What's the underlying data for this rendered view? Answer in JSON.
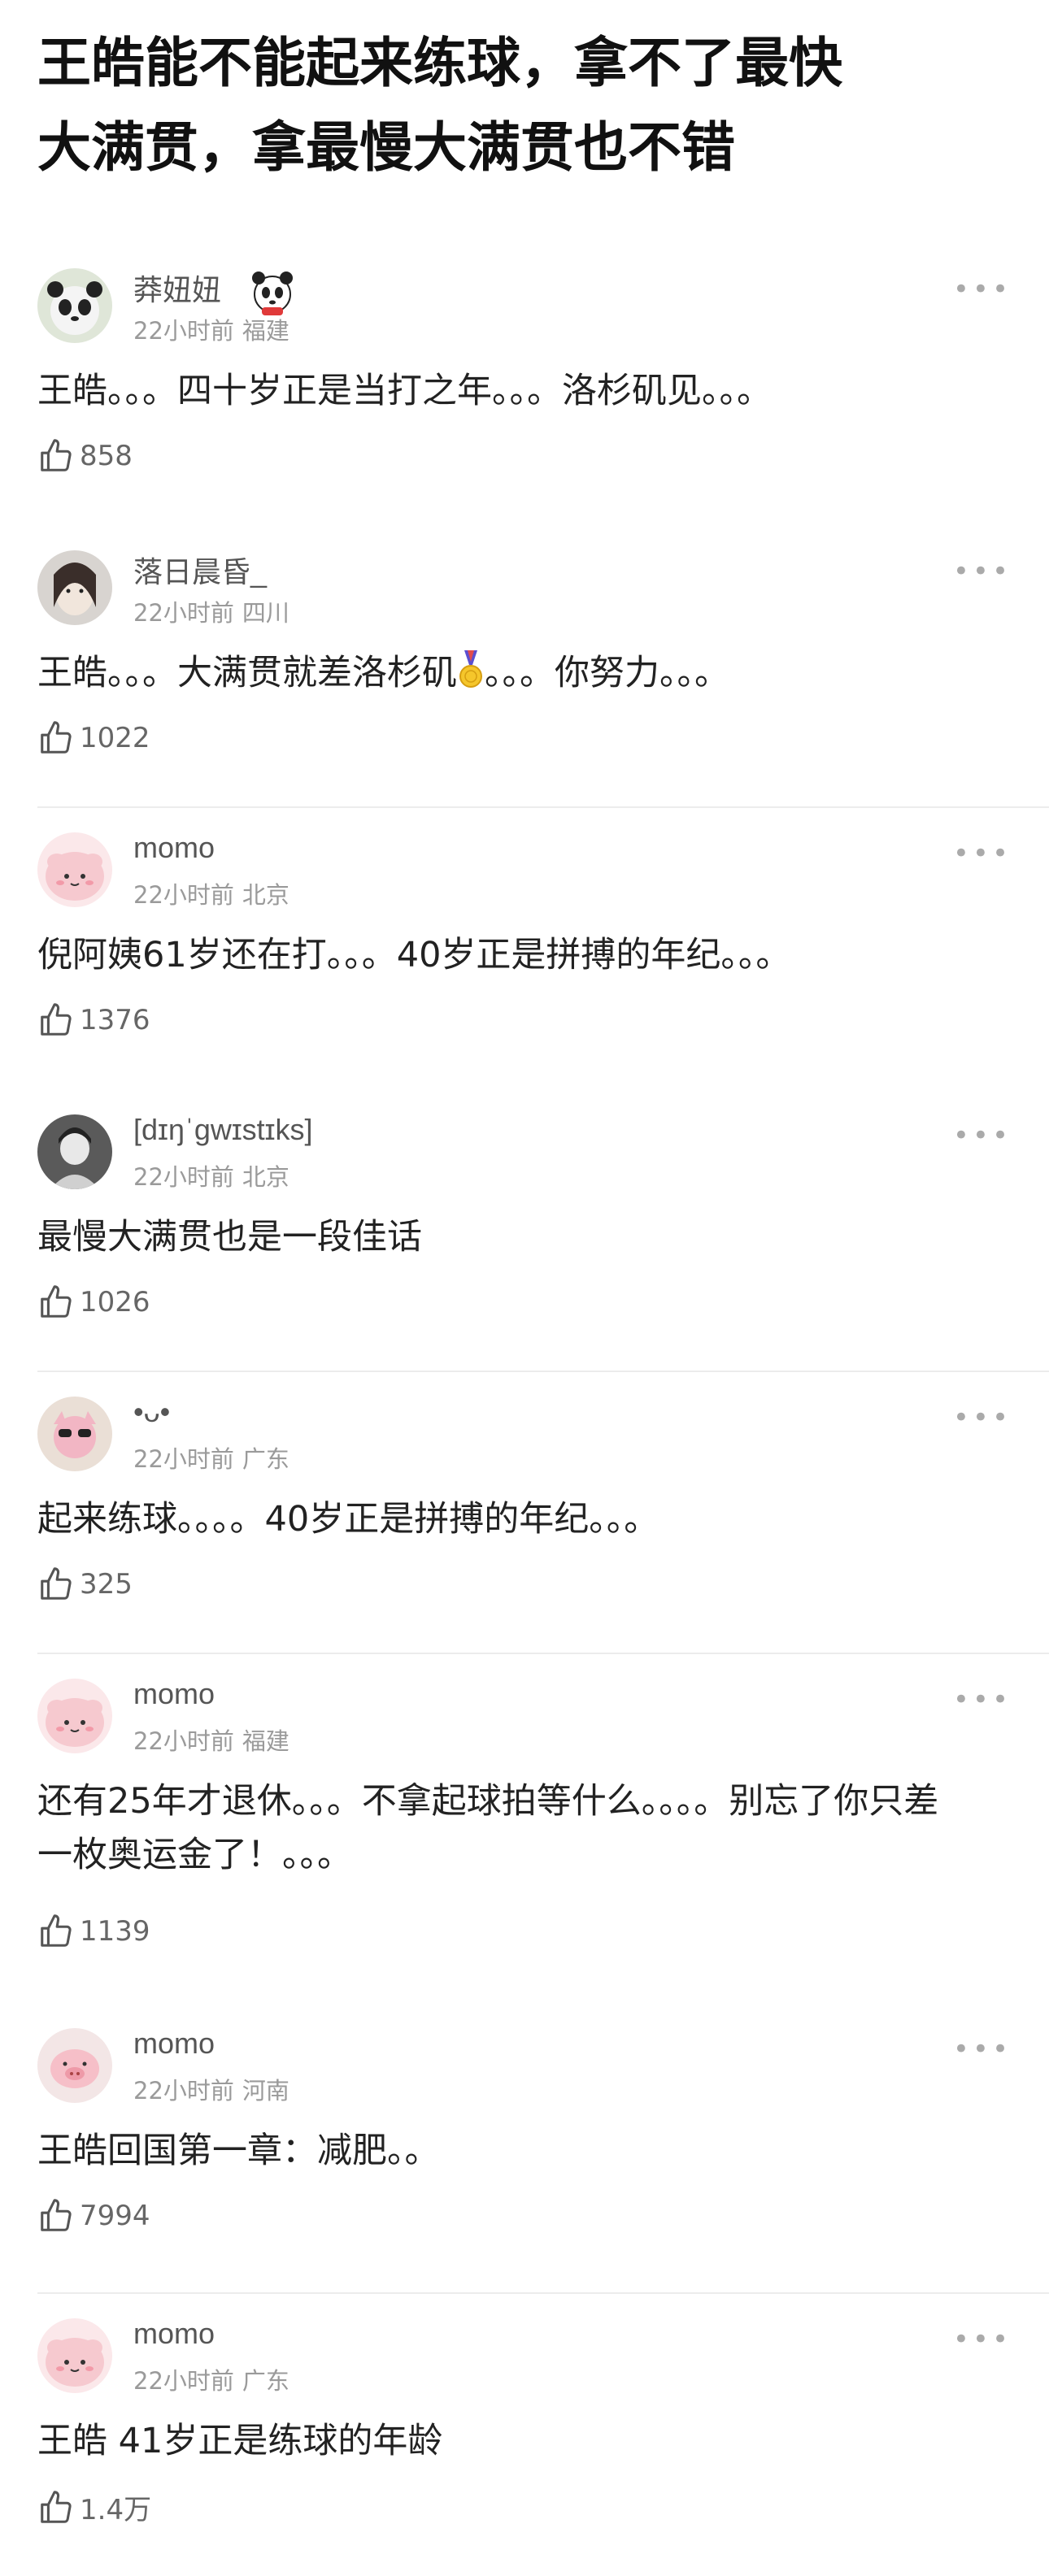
{
  "post": {
    "title": "王皓能不能起来练球，拿不了最快\n大满贯，拿最慢大满贯也不错"
  },
  "comments": [
    {
      "username": "莽妞妞",
      "time": "22小时前",
      "location": "福建",
      "text": "王皓。。。四十岁正是当打之年。。。洛杉矶见。。。",
      "likes": "858",
      "badge_icon": "panda-icon"
    },
    {
      "username": "落日晨昏_",
      "time": "22小时前",
      "location": "四川",
      "text_before": "王皓。。。大满贯就差洛杉矶",
      "text_after": "。。。你努力。。。",
      "likes": "1022",
      "inline_icon": "gold-medal-icon"
    },
    {
      "username": "momo",
      "time": "22小时前",
      "location": "北京",
      "text": "倪阿姨61岁还在打。。。40岁正是拼搏的年纪。。。",
      "likes": "1376"
    },
    {
      "username": "[dɪŋˈɡwɪstɪks]",
      "time": "22小时前",
      "location": "北京",
      "text": "最慢大满贯也是一段佳话",
      "likes": "1026"
    },
    {
      "username": "•ᴗ•",
      "time": "22小时前",
      "location": "广东",
      "text": "起来练球。。。。40岁正是拼搏的年纪。。。",
      "likes": "325"
    },
    {
      "username": "momo",
      "time": "22小时前",
      "location": "福建",
      "text": "还有25年才退休。。。不拿起球拍等什么。。。。别忘了你只差一枚奥运金了！。。。",
      "likes": "1139"
    },
    {
      "username": "momo",
      "time": "22小时前",
      "location": "河南",
      "text": "王皓回国第一章：减肥。。",
      "likes": "7994"
    },
    {
      "username": "momo",
      "time": "22小时前",
      "location": "广东",
      "text": "王皓 41岁正是练球的年龄",
      "likes": "1.4万"
    }
  ],
  "icons": {
    "more": "more-dots-icon",
    "like": "thumbs-up-icon"
  },
  "colors": {
    "meta_gray": "#9a9a9a",
    "divider": "#ececec",
    "avatar_pink": "#f7dfe2"
  }
}
